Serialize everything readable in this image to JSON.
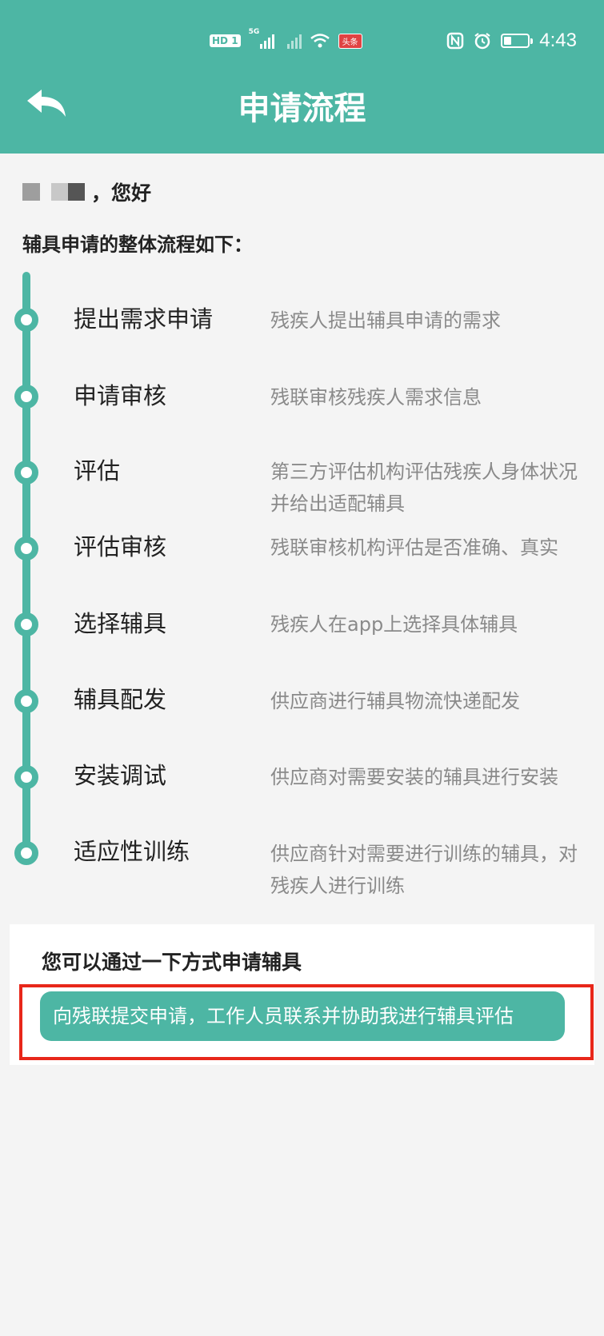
{
  "status_bar": {
    "hd_label": "HD",
    "sim_number": "1",
    "network_label": "5G",
    "badge_text": "头条",
    "time": "4:43",
    "battery_level": 0.4
  },
  "header": {
    "title": "申请流程",
    "back_icon": "back-arrow-icon",
    "color": "#4db6a4"
  },
  "greeting": {
    "suffix": "，您好"
  },
  "flow": {
    "heading": "辅具申请的整体流程如下：",
    "steps": [
      {
        "title": "提出需求申请",
        "desc": "残疾人提出辅具申请的需求"
      },
      {
        "title": "申请审核",
        "desc": "残联审核残疾人需求信息"
      },
      {
        "title": "评估",
        "desc": "第三方评估机构评估残疾人身体状况并给出适配辅具"
      },
      {
        "title": "评估审核",
        "desc": "残联审核机构评估是否准确、真实"
      },
      {
        "title": "选择辅具",
        "desc": "残疾人在app上选择具体辅具"
      },
      {
        "title": "辅具配发",
        "desc": "供应商进行辅具物流快递配发"
      },
      {
        "title": "安装调试",
        "desc": "供应商对需要安装的辅具进行安装"
      },
      {
        "title": "适应性训练",
        "desc": "供应商针对需要进行训练的辅具，对残疾人进行训练"
      }
    ]
  },
  "apply": {
    "heading": "您可以通过一下方式申请辅具",
    "option_label": "向残联提交申请，工作人员联系并协助我进行辅具评估",
    "highlight_color": "#e8271a"
  }
}
